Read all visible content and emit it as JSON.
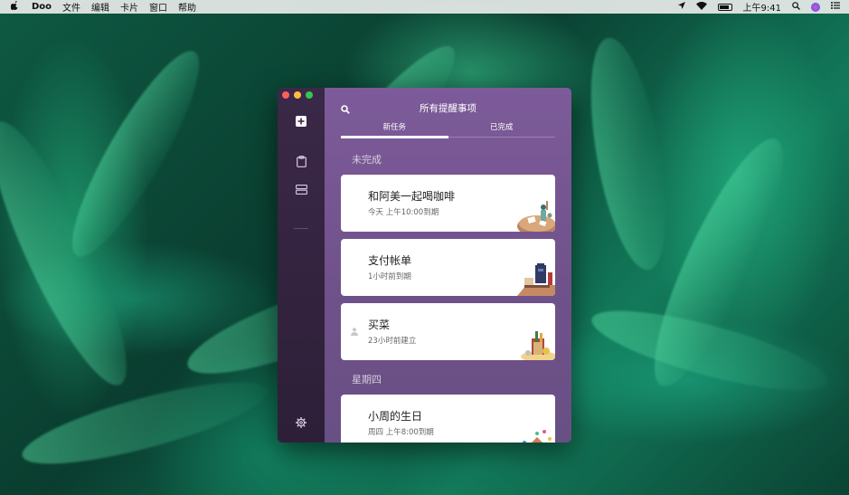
{
  "menubar": {
    "apple_icon": "apple-icon",
    "app_name": "Doo",
    "menus": [
      "文件",
      "编辑",
      "卡片",
      "窗口",
      "帮助"
    ],
    "clock": "上午9:41"
  },
  "window": {
    "title": "所有提醒事项",
    "tabs": [
      {
        "label": "新任务",
        "active": true
      },
      {
        "label": "已完成",
        "active": false
      }
    ],
    "sections": [
      {
        "label": "未完成",
        "cards": [
          {
            "title": "和阿美一起喝咖啡",
            "subtitle": "今天 上午10:00到期",
            "illustration": "coffee-table-illustration"
          },
          {
            "title": "支付帐单",
            "subtitle": "1小时前到期",
            "illustration": "mailbox-illustration"
          },
          {
            "title": "买菜",
            "subtitle": "23小时前建立",
            "illustration": "grocery-bag-illustration",
            "shows_person_icon": true
          }
        ]
      },
      {
        "label": "星期四",
        "cards": [
          {
            "title": "小周的生日",
            "subtitle": "周四 上午8:00到期",
            "illustration": "birthday-house-illustration"
          }
        ]
      }
    ]
  },
  "colors": {
    "sidebar": "#3b2848",
    "main_background": "#7d5b9a",
    "card": "#ffffff"
  }
}
